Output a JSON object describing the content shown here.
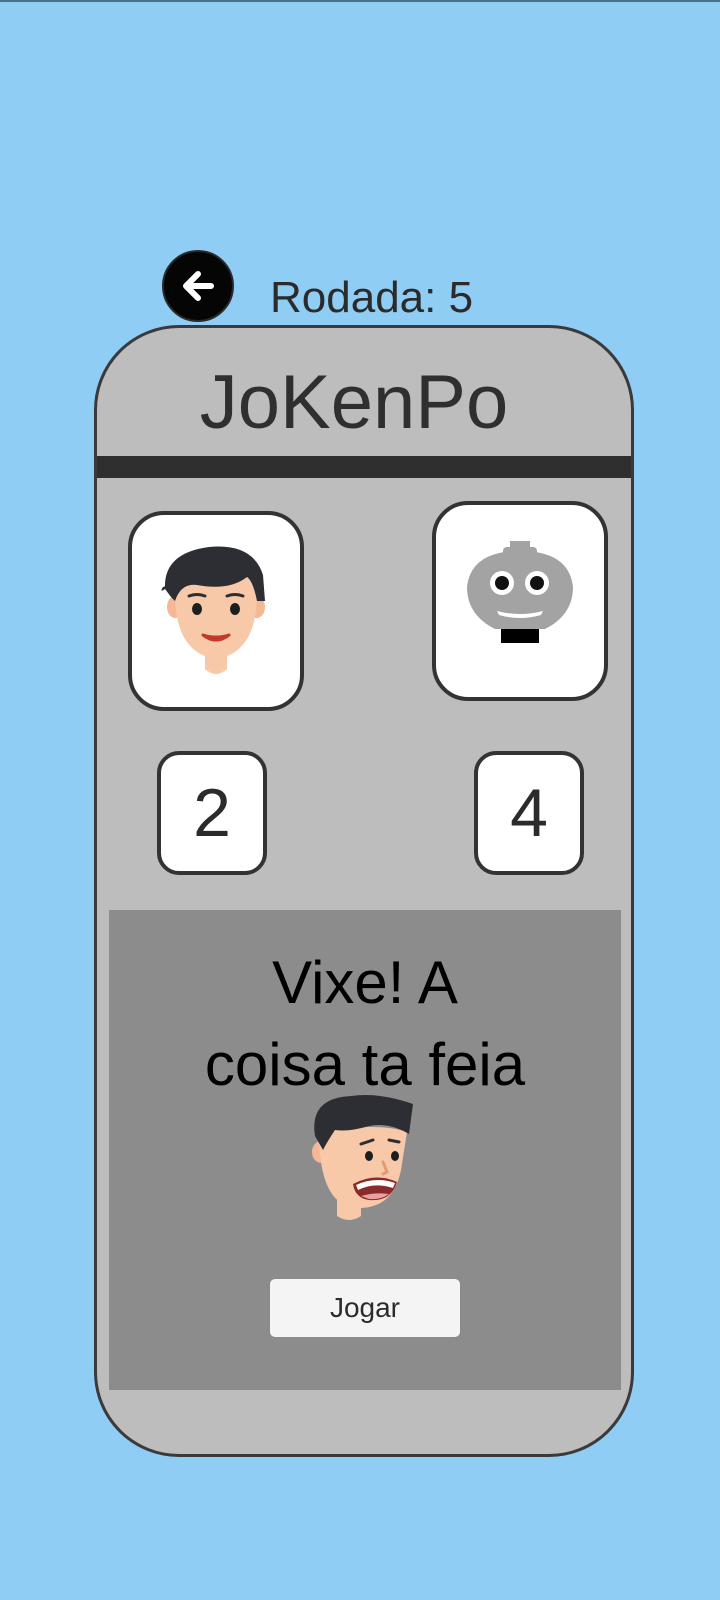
{
  "round": {
    "text": "Rodada: 5"
  },
  "game": {
    "title": "JoKenPo"
  },
  "player": {
    "avatar": "player-avatar-icon",
    "score": "2"
  },
  "computer": {
    "avatar": "robot-avatar-icon",
    "score": "4"
  },
  "result": {
    "line1": "Vixe! A",
    "line2": "coisa ta feia",
    "icon": "scared-face-icon"
  },
  "actions": {
    "play_label": "Jogar",
    "back_icon": "arrow-left-icon"
  },
  "colors": {
    "background": "#8fcdf4",
    "device": "#bdbdbd",
    "result_panel": "#8c8c8c",
    "border": "#333333"
  }
}
